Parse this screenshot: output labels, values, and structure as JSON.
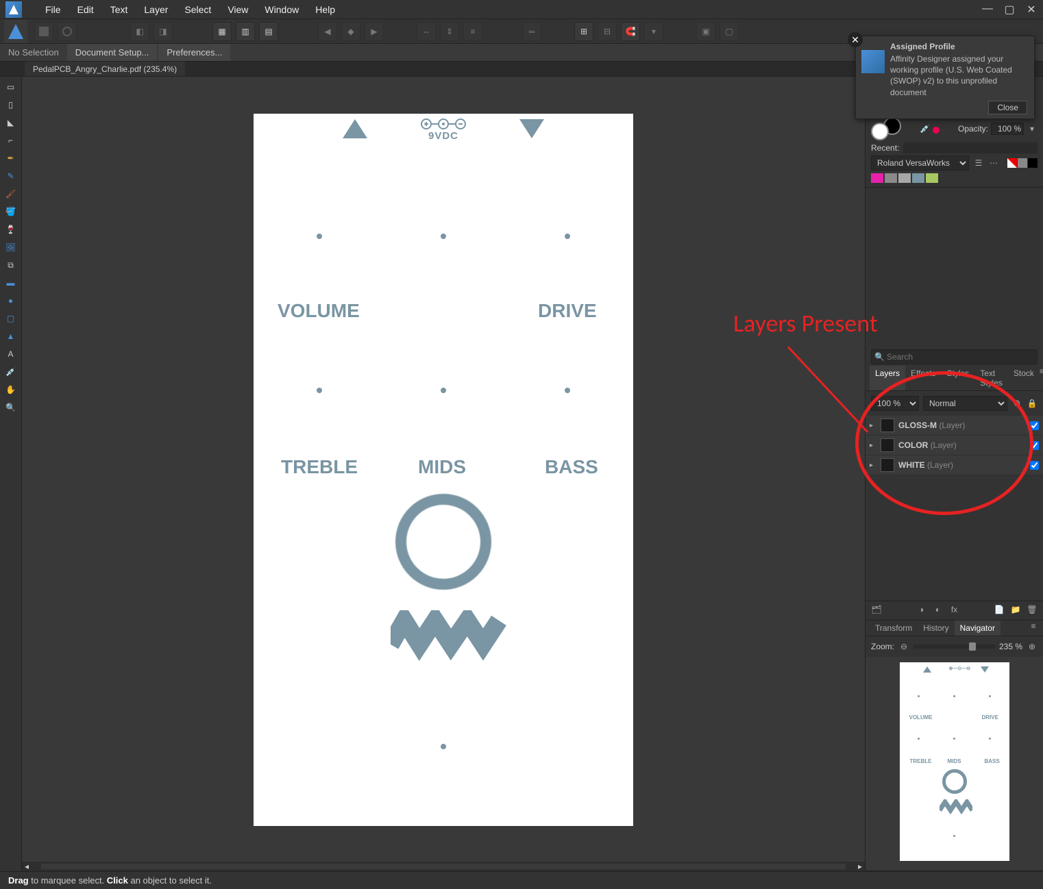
{
  "menu": {
    "items": [
      "File",
      "Edit",
      "Text",
      "Layer",
      "Select",
      "View",
      "Window",
      "Help"
    ]
  },
  "context_bar": {
    "no_selection": "No Selection",
    "doc_setup": "Document Setup...",
    "preferences": "Preferences..."
  },
  "document": {
    "tab_label": "PedalPCB_Angry_Charlie.pdf (235.4%)"
  },
  "artwork": {
    "power_label": "9VDC",
    "labels": [
      "VOLUME",
      "DRIVE",
      "TREBLE",
      "MIDS",
      "BASS"
    ]
  },
  "toast": {
    "title": "Assigned Profile",
    "body": "Affinity Designer assigned your working profile (U.S. Web Coated (SWOP) v2) to this unprofiled document",
    "close_btn": "Close"
  },
  "color_panel": {
    "opacity_label": "Opacity:",
    "opacity_value": "100 %",
    "recent_label": "Recent:",
    "palette_name": "Roland VersaWorks",
    "swatch_colors": [
      "#e722aa",
      "#8a8a8a",
      "#a8a8a8",
      "#7a95a3",
      "#a8c860"
    ]
  },
  "layers_panel": {
    "search_placeholder": "Search",
    "tabs": [
      "Layers",
      "Effects",
      "Styles",
      "Text Styles",
      "Stock"
    ],
    "active_tab": "Layers",
    "opacity_value": "100 %",
    "blend_mode": "Normal",
    "layers": [
      {
        "name": "GLOSS-M",
        "type": "(Layer)"
      },
      {
        "name": "COLOR",
        "type": "(Layer)"
      },
      {
        "name": "WHITE",
        "type": "(Layer)"
      }
    ]
  },
  "bottom_panel": {
    "tabs": [
      "Transform",
      "History",
      "Navigator"
    ],
    "active_tab": "Navigator",
    "zoom_label": "Zoom:",
    "zoom_value": "235 %"
  },
  "status_bar": {
    "drag_strong": "Drag",
    "drag_text": " to marquee select. ",
    "click_strong": "Click",
    "click_text": " an object to select it."
  },
  "annotation": {
    "text": "Layers Present"
  },
  "nav_preview": {
    "labels": [
      "VOLUME",
      "DRIVE",
      "TREBLE",
      "MIDS",
      "BASS"
    ]
  }
}
